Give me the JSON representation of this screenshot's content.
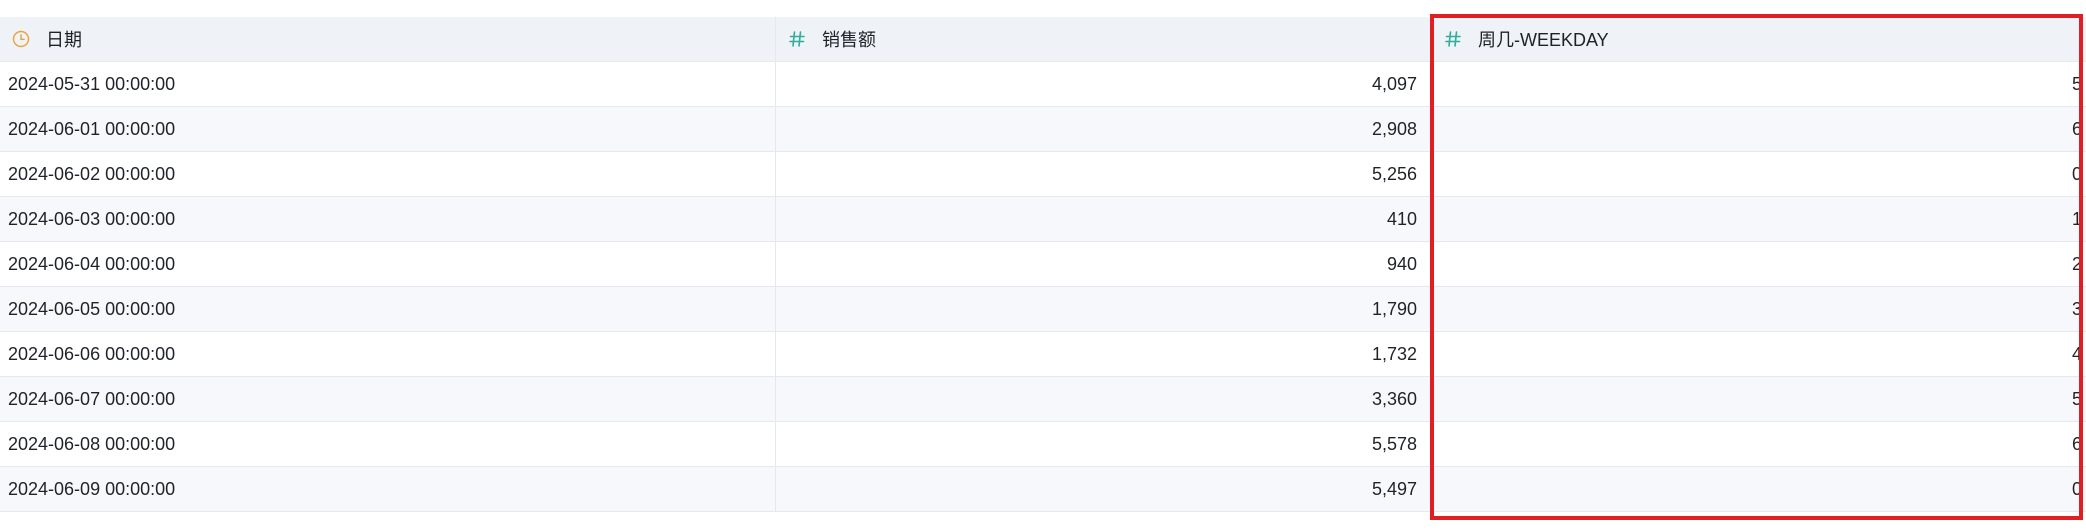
{
  "columns": [
    {
      "label": "日期",
      "icon": "clock-icon",
      "icon_color": "#e8a33d"
    },
    {
      "label": "销售额",
      "icon": "hash-icon",
      "icon_color": "#2fae9c"
    },
    {
      "label": "周几-WEEKDAY",
      "icon": "hash-icon",
      "icon_color": "#2fae9c"
    }
  ],
  "rows": [
    {
      "date": "2024-05-31 00:00:00",
      "sales": "4,097",
      "weekday": "5"
    },
    {
      "date": "2024-06-01 00:00:00",
      "sales": "2,908",
      "weekday": "6"
    },
    {
      "date": "2024-06-02 00:00:00",
      "sales": "5,256",
      "weekday": "0"
    },
    {
      "date": "2024-06-03 00:00:00",
      "sales": "410",
      "weekday": "1"
    },
    {
      "date": "2024-06-04 00:00:00",
      "sales": "940",
      "weekday": "2"
    },
    {
      "date": "2024-06-05 00:00:00",
      "sales": "1,790",
      "weekday": "3"
    },
    {
      "date": "2024-06-06 00:00:00",
      "sales": "1,732",
      "weekday": "4"
    },
    {
      "date": "2024-06-07 00:00:00",
      "sales": "3,360",
      "weekday": "5"
    },
    {
      "date": "2024-06-08 00:00:00",
      "sales": "5,578",
      "weekday": "6"
    },
    {
      "date": "2024-06-09 00:00:00",
      "sales": "5,497",
      "weekday": "0"
    }
  ],
  "highlight_color": "#e01f25"
}
